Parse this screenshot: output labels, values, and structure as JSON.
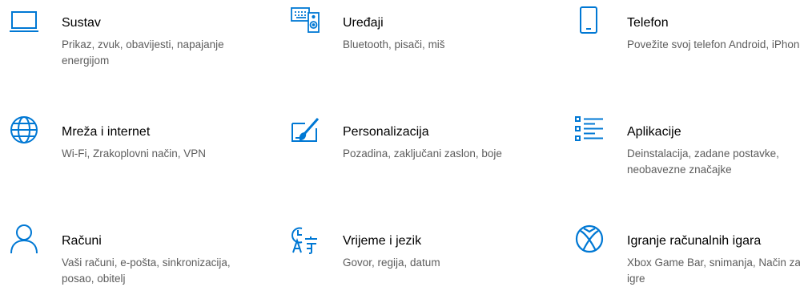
{
  "accent_color": "#0078d4",
  "tiles": [
    {
      "icon": "laptop-icon",
      "title": "Sustav",
      "desc": "Prikaz, zvuk, obavijesti, napajanje energijom"
    },
    {
      "icon": "devices-icon",
      "title": "Uređaji",
      "desc": "Bluetooth, pisači, miš"
    },
    {
      "icon": "phone-icon",
      "title": "Telefon",
      "desc": "Povežite svoj telefon Android, iPhone"
    },
    {
      "icon": "globe-icon",
      "title": "Mreža i internet",
      "desc": "Wi-Fi, Zrakoplovni način, VPN"
    },
    {
      "icon": "personalization-icon",
      "title": "Personalizacija",
      "desc": "Pozadina, zaključani zaslon, boje"
    },
    {
      "icon": "apps-list-icon",
      "title": "Aplikacije",
      "desc": "Deinstalacija, zadane postavke, neobavezne značajke"
    },
    {
      "icon": "person-icon",
      "title": "Računi",
      "desc": "Vaši računi, e-pošta, sinkronizacija, posao, obitelj"
    },
    {
      "icon": "time-language-icon",
      "title": "Vrijeme i jezik",
      "desc": "Govor, regija, datum"
    },
    {
      "icon": "xbox-icon",
      "title": "Igranje računalnih igara",
      "desc": "Xbox Game Bar, snimanja, Način za igre"
    }
  ]
}
